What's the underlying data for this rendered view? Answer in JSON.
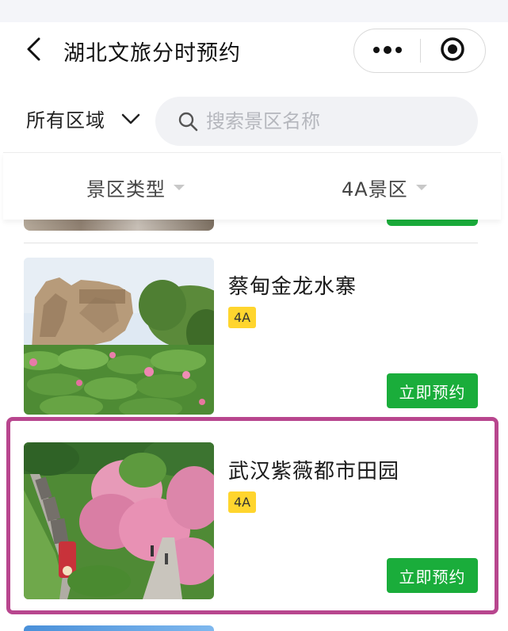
{
  "header": {
    "title": "湖北文旅分时预约",
    "back_icon": "back-arrow-icon",
    "more_icon": "more-dots-icon",
    "close_icon": "mini-program-close-icon"
  },
  "search": {
    "region_label": "所有区域",
    "placeholder": "搜索景区名称",
    "value": ""
  },
  "filters": [
    {
      "label": "景区类型"
    },
    {
      "label": "4A景区"
    }
  ],
  "scenic_spots": [
    {
      "name": "蔡甸金龙水寨",
      "level": "4A",
      "book_label": "立即预约"
    },
    {
      "name": "武汉紫薇都市田园",
      "level": "4A",
      "book_label": "立即预约"
    }
  ],
  "colors": {
    "book_button": "#1aad3b",
    "badge": "#ffd52e",
    "highlight": "#b8468e"
  }
}
